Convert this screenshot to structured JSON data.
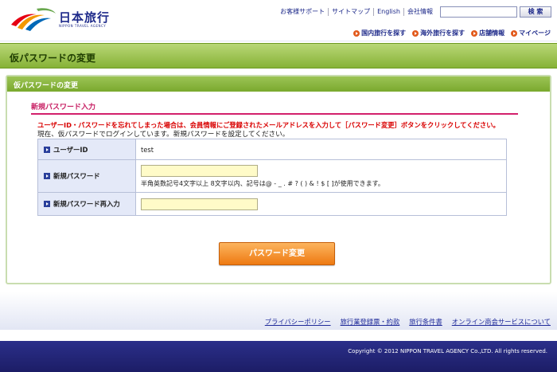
{
  "header": {
    "logo_title": "日本旅行",
    "logo_sub": "NIPPON TRAVEL AGENCY",
    "util_links": [
      "お客様サポート",
      "サイトマップ",
      "English",
      "会社情報"
    ],
    "search_button": "検 索",
    "nav": [
      "国内旅行を探す",
      "海外旅行を探す",
      "店舗情報",
      "マイページ"
    ],
    "colors": {
      "brand": "#1e2a8a",
      "accent": "#e25a1c"
    }
  },
  "page": {
    "title": "仮パスワードの変更",
    "panel_title": "仮パスワードの変更",
    "section_title": "新規パスワード入力",
    "warning": "ユーザーID・パスワードを忘れてしまった場合は、会員情報にご登録されたメールアドレスを入力して［パスワード変更］ボタンをクリックしてください。",
    "note": "現在、仮パスワードでログインしています。新規パスワードを設定してください。"
  },
  "form": {
    "user_id_label": "ユーザーID",
    "user_id_value": "test",
    "new_pw_label": "新規パスワード",
    "new_pw_hint": "半角英数記号4文字以上 8文字以内、記号は@ - _ . # ? ( ) & ! $ [ ]が使用できます。",
    "confirm_pw_label": "新規パスワード再入力",
    "submit_label": "パスワード変更"
  },
  "footer": {
    "links": [
      "プライバシーポリシー",
      "旅行業登録票・約款",
      "旅行条件書",
      "オンライン商会サービスについて"
    ],
    "copyright": "Copyright © 2012 NIPPON TRAVEL AGENCY Co.,LTD. All rights reserved."
  }
}
